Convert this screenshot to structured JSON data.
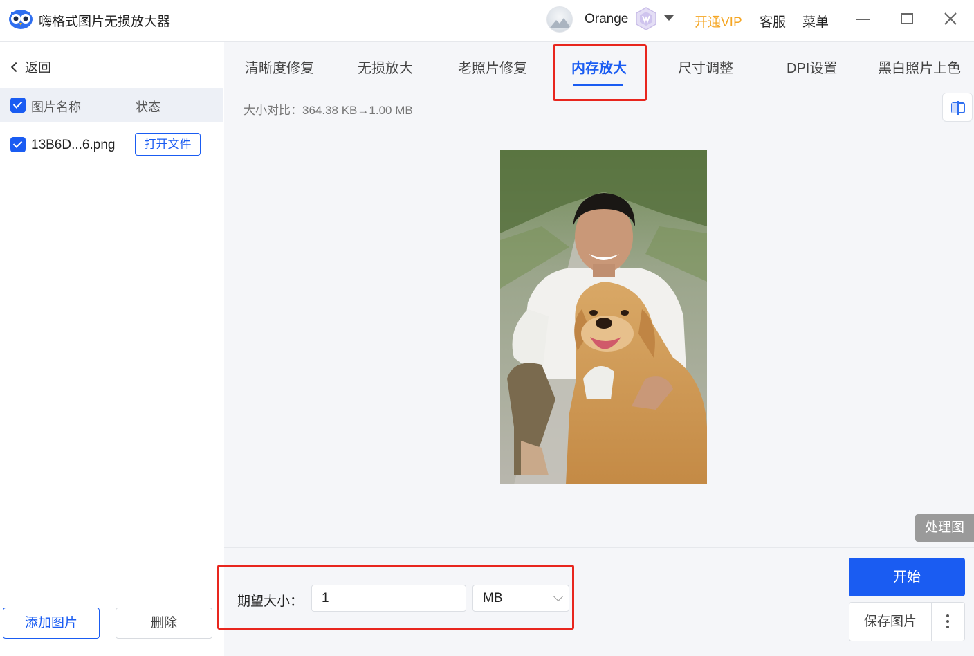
{
  "app": {
    "title": "嗨格式图片无损放大器",
    "logo_icon": "owl-logo-icon"
  },
  "titlebar": {
    "username": "Orange",
    "vip_link": "开通VIP",
    "service": "客服",
    "menu": "菜单",
    "vip_color": "#f5a623"
  },
  "sidebar": {
    "back_label": "返回",
    "columns": {
      "name": "图片名称",
      "status": "状态"
    },
    "files": [
      {
        "name": "13B6D...6.png",
        "action": "打开文件",
        "checked": true
      }
    ],
    "add_button": "添加图片",
    "delete_button": "删除"
  },
  "tabs": [
    {
      "label": "清晰度修复",
      "active": false
    },
    {
      "label": "无损放大",
      "active": false
    },
    {
      "label": "老照片修复",
      "active": false
    },
    {
      "label": "内存放大",
      "active": true
    },
    {
      "label": "尺寸调整",
      "active": false
    },
    {
      "label": "DPI设置",
      "active": false
    },
    {
      "label": "黑白照片上色",
      "active": false
    }
  ],
  "preview": {
    "size_compare": "大小对比：364.38 KB→1.00 MB",
    "processed_label": "处理图"
  },
  "settings": {
    "expect_label": "期望大小：",
    "size_value": "1",
    "unit": "MB"
  },
  "actions": {
    "start": "开始",
    "save": "保存图片"
  },
  "colors": {
    "accent": "#1a5cf2",
    "highlight": "#e8261e"
  }
}
